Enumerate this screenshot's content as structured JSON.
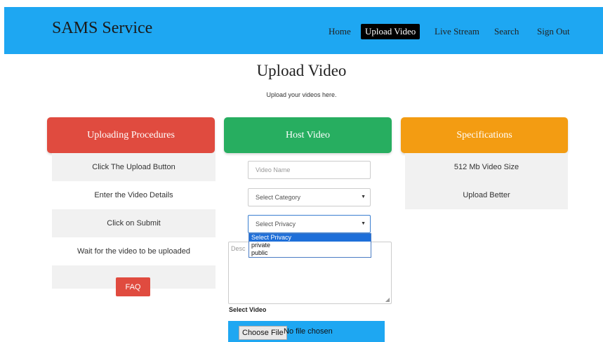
{
  "navbar": {
    "brand": "SAMS Service",
    "links": [
      "Home",
      "Upload Video",
      "Live Stream",
      "Search",
      "Sign Out"
    ],
    "active": "Upload Video",
    "color": "#1ea7f2"
  },
  "header": {
    "title": "Upload Video",
    "subtitle": "Upload your videos here."
  },
  "procedures": {
    "title": "Uploading Procedures",
    "color": "#e04b3f",
    "items": [
      "Click The Upload Button",
      "Enter the Video Details",
      "Click on Submit",
      "Wait for the video to be uploaded"
    ],
    "faq_label": "FAQ"
  },
  "host": {
    "title": "Host Video",
    "color": "#27ae60",
    "video_name_placeholder": "Video Name",
    "category_value": "Select Category",
    "privacy_value": "Select Privacy",
    "privacy_options": [
      "Select Privacy",
      "private",
      "public"
    ],
    "description_placeholder": "Desc",
    "select_video_label": "Select Video",
    "choose_file_label": "Choose File",
    "no_file_text": "No file chosen"
  },
  "specs": {
    "title": "Specifications",
    "color": "#f39c12",
    "items": [
      "512 Mb Video Size",
      "Upload Better"
    ]
  }
}
